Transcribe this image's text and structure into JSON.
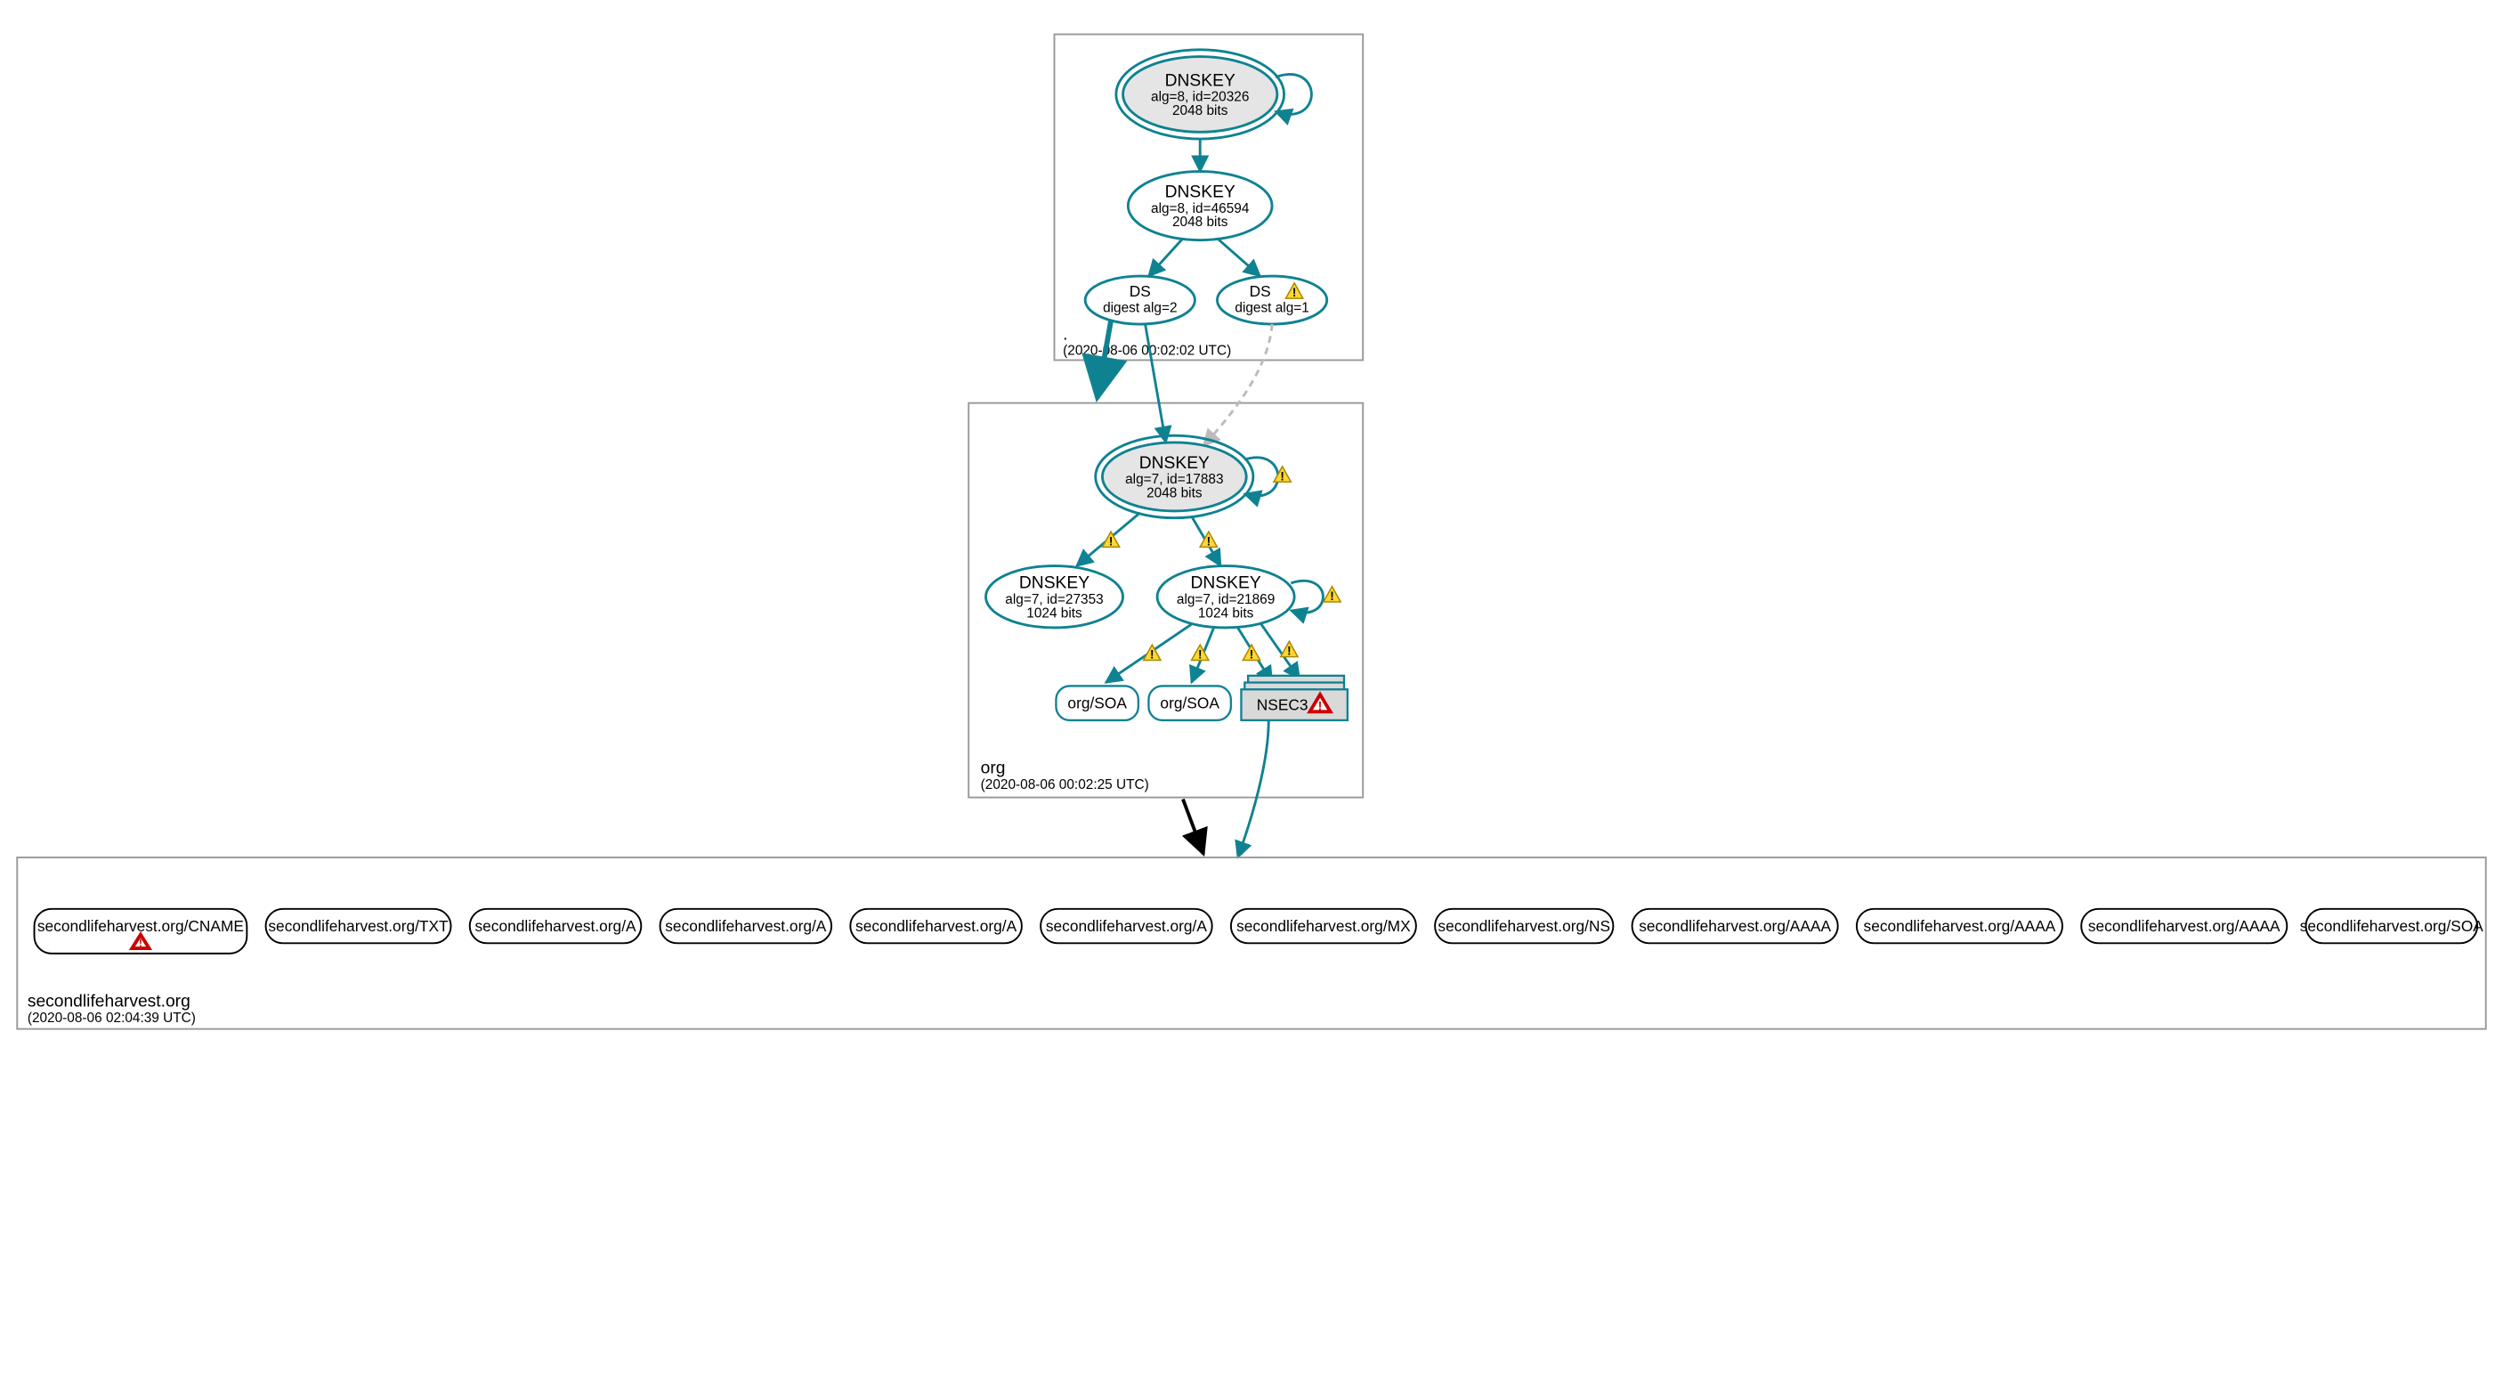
{
  "zones": {
    "root": {
      "label": ".",
      "timestamp": "(2020-08-06 00:02:02 UTC)"
    },
    "org": {
      "label": "org",
      "timestamp": "(2020-08-06 00:02:25 UTC)"
    },
    "domain": {
      "label": "secondlifeharvest.org",
      "timestamp": "(2020-08-06 02:04:39 UTC)"
    }
  },
  "root_keys": {
    "ksk": {
      "title": "DNSKEY",
      "line1": "alg=8, id=20326",
      "line2": "2048 bits"
    },
    "zsk": {
      "title": "DNSKEY",
      "line1": "alg=8, id=46594",
      "line2": "2048 bits"
    },
    "ds1": {
      "title": "DS",
      "line1": "digest alg=2"
    },
    "ds2": {
      "title": "DS",
      "line1": "digest alg=1"
    }
  },
  "org_keys": {
    "ksk": {
      "title": "DNSKEY",
      "line1": "alg=7, id=17883",
      "line2": "2048 bits"
    },
    "zsk1": {
      "title": "DNSKEY",
      "line1": "alg=7, id=27353",
      "line2": "1024 bits"
    },
    "zsk2": {
      "title": "DNSKEY",
      "line1": "alg=7, id=21869",
      "line2": "1024 bits"
    }
  },
  "org_rrsets": {
    "soa1": "org/SOA",
    "soa2": "org/SOA",
    "nsec3": "NSEC3"
  },
  "bottom_records": [
    "secondlifeharvest.org/CNAME",
    "secondlifeharvest.org/TXT",
    "secondlifeharvest.org/A",
    "secondlifeharvest.org/A",
    "secondlifeharvest.org/A",
    "secondlifeharvest.org/A",
    "secondlifeharvest.org/MX",
    "secondlifeharvest.org/NS",
    "secondlifeharvest.org/AAAA",
    "secondlifeharvest.org/AAAA",
    "secondlifeharvest.org/AAAA",
    "secondlifeharvest.org/SOA"
  ],
  "colors": {
    "teal": "#0f8291",
    "greyfill": "#e5e5e5"
  }
}
